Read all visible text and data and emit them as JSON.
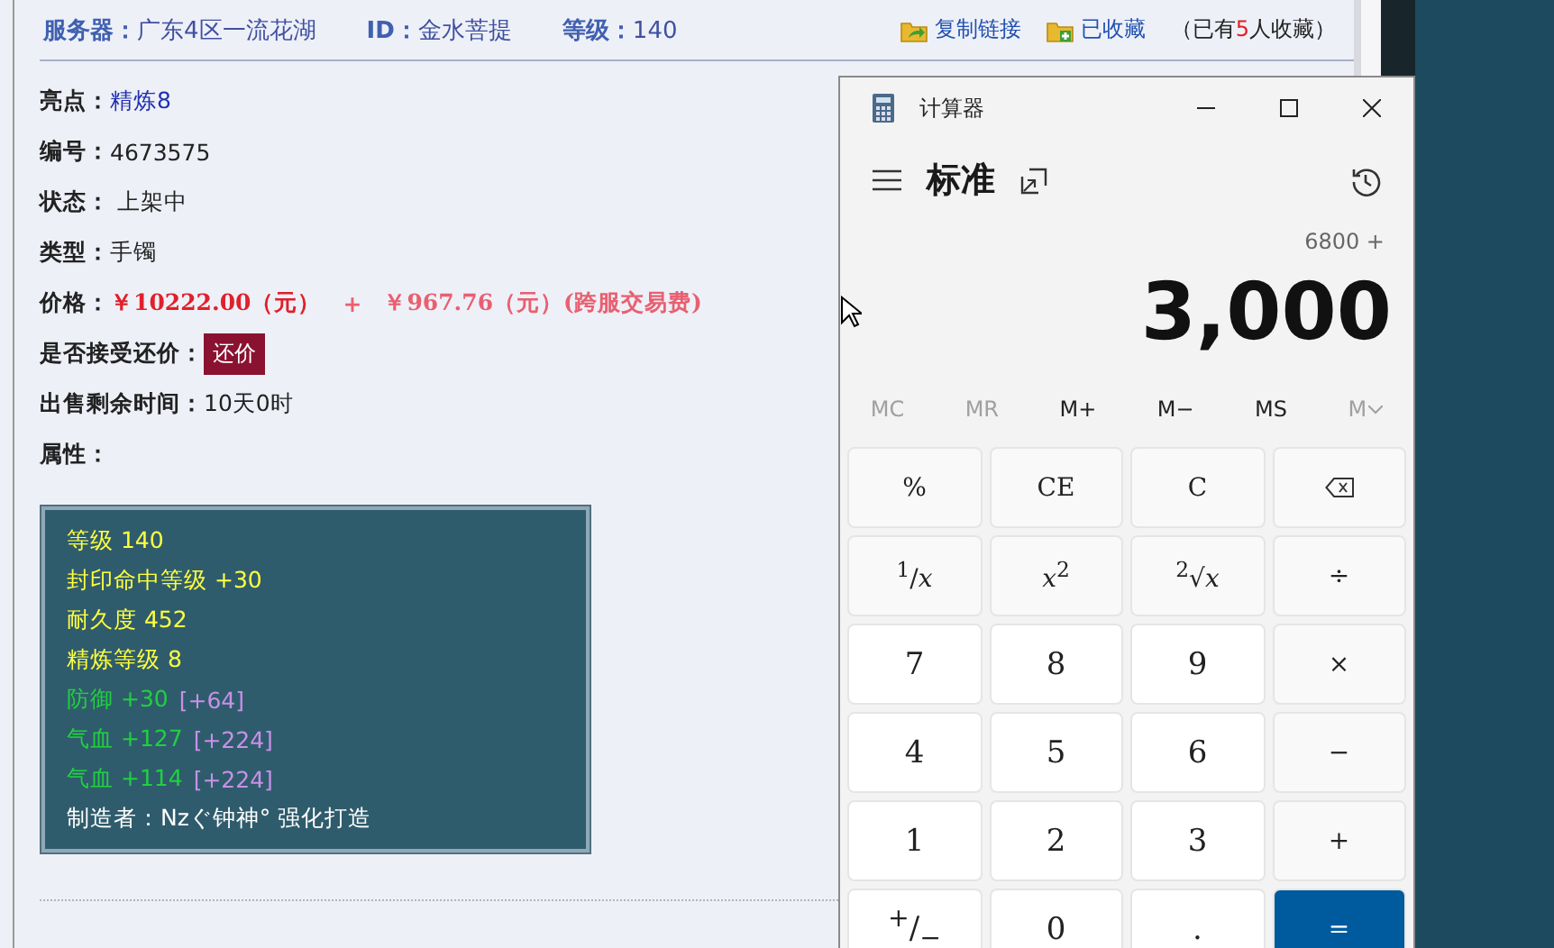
{
  "header": {
    "fields": [
      {
        "label": "服务器：",
        "value": "广东4区一流花湖"
      },
      {
        "label": "ID：",
        "value": "金水菩提"
      },
      {
        "label": "等级：",
        "value": "140"
      }
    ],
    "actions": [
      {
        "kind": "share",
        "label": "复制链接"
      },
      {
        "kind": "favorite",
        "label": "已收藏"
      }
    ],
    "favorites_note": {
      "prefix": "（已有",
      "count": "5",
      "suffix": "人收藏）"
    }
  },
  "details": [
    {
      "label": "亮点：",
      "kind": "link",
      "value": "精炼8"
    },
    {
      "label": "编号：",
      "kind": "text",
      "value": "4673575"
    },
    {
      "label": "状态：",
      "kind": "text",
      "value": " 上架中"
    },
    {
      "label": "类型：",
      "kind": "text",
      "value": "手镯"
    },
    {
      "label": "价格：",
      "kind": "price",
      "parts": [
        {
          "text": "￥10222.00（元）",
          "color": "#e0202a"
        },
        {
          "text": "+",
          "color": "#e86070"
        },
        {
          "text": "￥967.76（元）(跨服交易费)",
          "color": "#e86070"
        }
      ]
    },
    {
      "label": "是否接受还价：",
      "kind": "button",
      "value": "还价"
    },
    {
      "label": "出售剩余时间：",
      "kind": "text",
      "value": "10天0时"
    },
    {
      "label": "属性：",
      "kind": "none"
    }
  ],
  "attributes": [
    [
      {
        "text": "等级 140",
        "color": "#ffff40"
      }
    ],
    [
      {
        "text": "封印命中等级 +30",
        "color": "#ffff40"
      }
    ],
    [
      {
        "text": "耐久度 452",
        "color": "#ffff40"
      }
    ],
    [
      {
        "text": "精炼等级 8",
        "color": "#ffff40"
      }
    ],
    [
      {
        "text": "防御 +30",
        "color": "#20d040"
      },
      {
        "text": "[+64]",
        "color": "#c890e8"
      }
    ],
    [
      {
        "text": "气血 +127",
        "color": "#20d040"
      },
      {
        "text": "[+224]",
        "color": "#c890e8"
      }
    ],
    [
      {
        "text": "气血 +114",
        "color": "#20d040"
      },
      {
        "text": "[+224]",
        "color": "#c890e8"
      }
    ],
    [
      {
        "text": "制造者：Nzぐ钟神° 强化打造",
        "color": "#ffffff"
      }
    ]
  ],
  "calculator": {
    "title": "计算器",
    "mode": "标准",
    "expression": "6800 +",
    "display": "3,000",
    "memory": [
      {
        "label": "MC",
        "disabled": true,
        "has_menu": false
      },
      {
        "label": "MR",
        "disabled": true,
        "has_menu": false
      },
      {
        "label": "M+",
        "disabled": false,
        "has_menu": false
      },
      {
        "label": "M−",
        "disabled": false,
        "has_menu": false
      },
      {
        "label": "MS",
        "disabled": false,
        "has_menu": false
      },
      {
        "label": "M",
        "disabled": true,
        "has_menu": true
      }
    ],
    "keys": [
      {
        "kind": "func",
        "label": "%"
      },
      {
        "kind": "func",
        "label": "CE"
      },
      {
        "kind": "func",
        "label": "C"
      },
      {
        "kind": "backspace"
      },
      {
        "kind": "func",
        "label": "$^{1}$/*x*"
      },
      {
        "kind": "func",
        "label": "*x*$^{2}$"
      },
      {
        "kind": "func",
        "label": "$^{2}$√*x*"
      },
      {
        "kind": "func",
        "label": "÷"
      },
      {
        "kind": "digit",
        "label": "7"
      },
      {
        "kind": "digit",
        "label": "8"
      },
      {
        "kind": "digit",
        "label": "9"
      },
      {
        "kind": "func",
        "label": "×"
      },
      {
        "kind": "digit",
        "label": "4"
      },
      {
        "kind": "digit",
        "label": "5"
      },
      {
        "kind": "digit",
        "label": "6"
      },
      {
        "kind": "func",
        "label": "−"
      },
      {
        "kind": "digit",
        "label": "1"
      },
      {
        "kind": "digit",
        "label": "2"
      },
      {
        "kind": "digit",
        "label": "3"
      },
      {
        "kind": "func",
        "label": "+"
      },
      {
        "kind": "digit",
        "label": "$^{+}$/$_{−}$"
      },
      {
        "kind": "digit",
        "label": "0"
      },
      {
        "kind": "digit",
        "label": "."
      },
      {
        "kind": "equals",
        "label": "="
      }
    ]
  }
}
